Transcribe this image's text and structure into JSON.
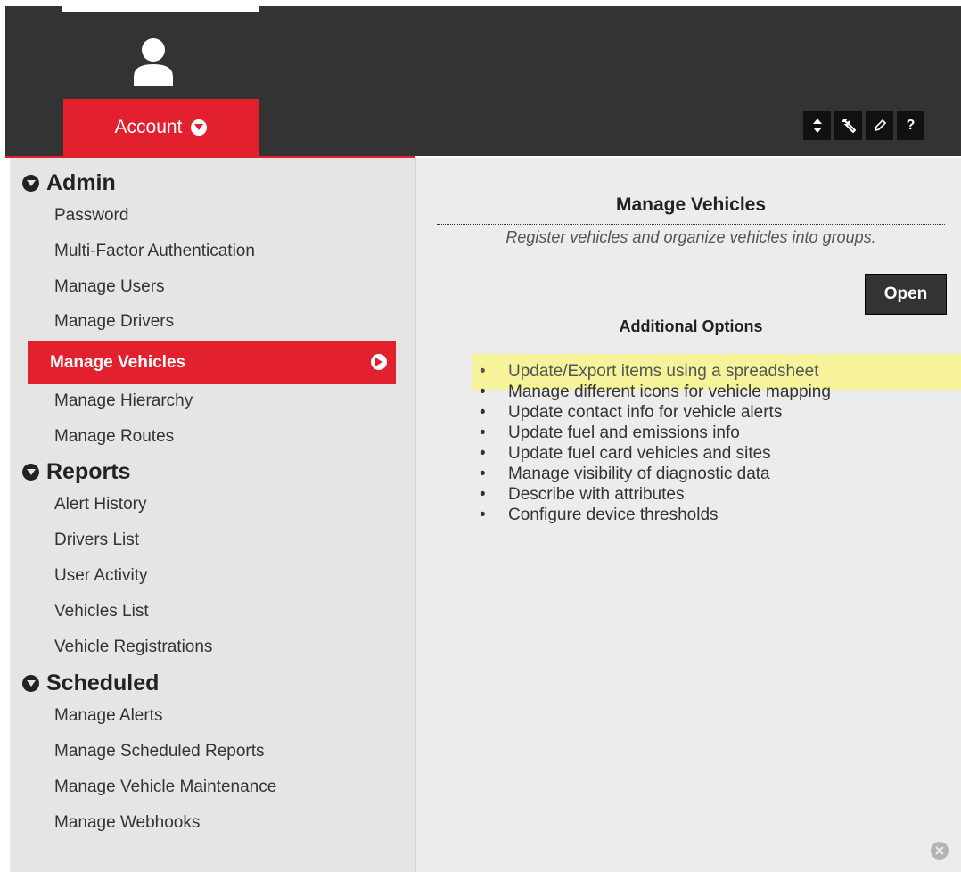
{
  "header": {
    "account_label": "Account",
    "tools": [
      {
        "name": "sort-icon",
        "glyph": "⬍"
      },
      {
        "name": "wrench-icon",
        "glyph": "🔧"
      },
      {
        "name": "pencil-icon",
        "glyph": "✎"
      },
      {
        "name": "help-icon",
        "glyph": "?"
      }
    ]
  },
  "sidebar": {
    "admin": {
      "title": "Admin",
      "items": [
        "Password",
        "Multi-Factor Authentication",
        "Manage Users",
        "Manage Drivers",
        "Manage Vehicles",
        "Manage Hierarchy",
        "Manage Routes"
      ]
    },
    "reports": {
      "title": "Reports",
      "items": [
        "Alert History",
        "Drivers List",
        "User Activity",
        "Vehicles List",
        "Vehicle Registrations"
      ]
    },
    "scheduled": {
      "title": "Scheduled",
      "items": [
        "Manage Alerts",
        "Manage Scheduled Reports",
        "Manage Vehicle Maintenance",
        "Manage Webhooks"
      ]
    }
  },
  "main": {
    "title": "Manage Vehicles",
    "description": "Register vehicles and organize vehicles into groups.",
    "open_label": "Open",
    "additional_title": "Additional Options",
    "options": [
      "Update/Export items using a spreadsheet",
      "Manage different icons for vehicle mapping",
      "Update contact info for vehicle alerts",
      "Update fuel and emissions info",
      "Update fuel card vehicles and sites",
      "Manage visibility of diagnostic data",
      "Describe with attributes",
      "Configure device thresholds"
    ]
  },
  "colors": {
    "accent_red": "#e3202d",
    "header_dark": "#333333",
    "highlight": "#f6f39a"
  }
}
